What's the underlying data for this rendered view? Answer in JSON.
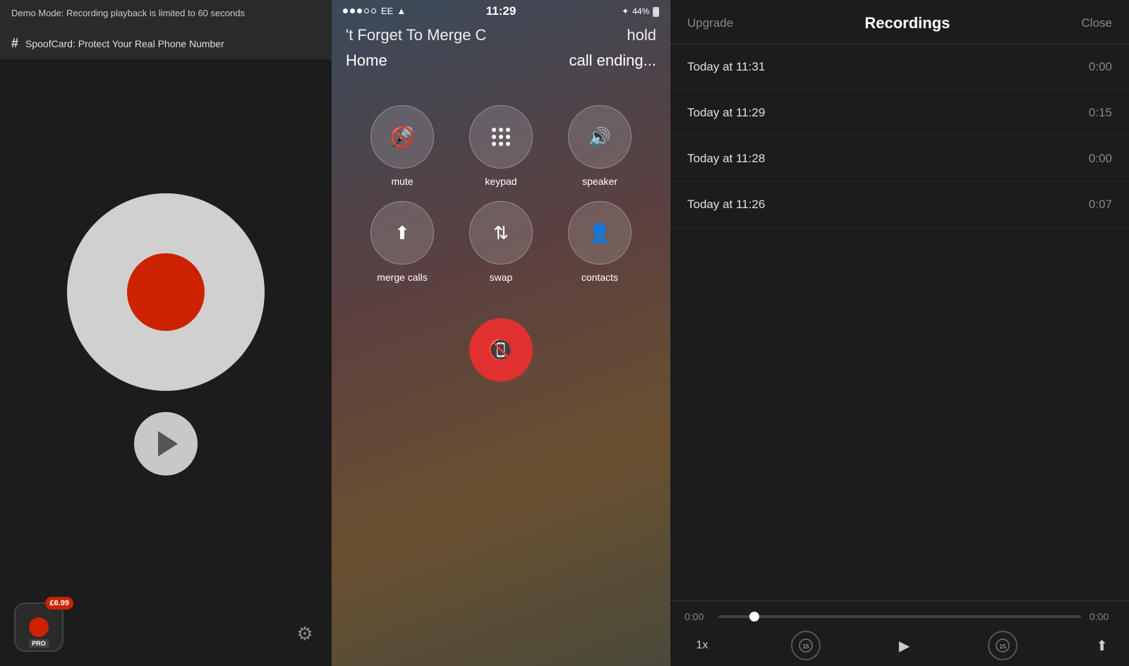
{
  "left": {
    "demo_banner": "Demo Mode: Recording playback is limited to 60 seconds",
    "spoof_label": "SpoofCard: Protect Your Real Phone Number",
    "price_badge": "£6.99",
    "pro_label": "PRO",
    "settings_icon": "⚙"
  },
  "middle": {
    "status": {
      "carrier": "EE",
      "time": "11:29",
      "battery": "44%"
    },
    "call_title": "'t Forget To Merge C",
    "call_hold": "hold",
    "call_home": "Home",
    "call_ending": "call ending...",
    "buttons": [
      {
        "id": "mute",
        "label": "mute"
      },
      {
        "id": "keypad",
        "label": "keypad"
      },
      {
        "id": "speaker",
        "label": "speaker"
      },
      {
        "id": "merge",
        "label": "merge calls"
      },
      {
        "id": "swap",
        "label": "swap"
      },
      {
        "id": "contacts",
        "label": "contacts"
      }
    ]
  },
  "right": {
    "title": "Recordings",
    "upgrade_label": "Upgrade",
    "close_label": "Close",
    "recordings": [
      {
        "time": "Today at 11:31",
        "duration": "0:00"
      },
      {
        "time": "Today at 11:29",
        "duration": "0:15"
      },
      {
        "time": "Today at 11:28",
        "duration": "0:00"
      },
      {
        "time": "Today at 11:26",
        "duration": "0:07"
      }
    ],
    "player": {
      "current_time": "0:00",
      "total_time": "0:00",
      "speed": "1x",
      "rewind_label": "15",
      "forward_label": "15"
    }
  }
}
